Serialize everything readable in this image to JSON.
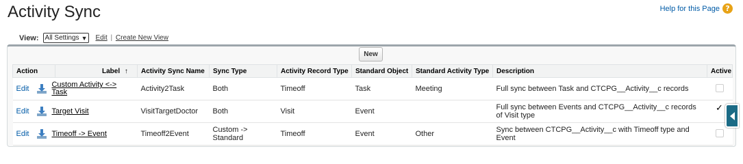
{
  "page": {
    "title": "Activity Sync",
    "help_link": "Help for this Page",
    "help_icon": "?"
  },
  "view": {
    "label": "View:",
    "selected": "All Settings",
    "edit_link": "Edit",
    "separator": "|",
    "create_link": "Create New View"
  },
  "toolbar": {
    "new_label": "New"
  },
  "table": {
    "headers": {
      "action": "Action",
      "label": "Label",
      "sort_indicator": "↑",
      "name": "Activity Sync Name",
      "sync_type": "Sync Type",
      "record_type": "Activity Record Type",
      "std_object": "Standard Object",
      "std_activity_type": "Standard Activity Type",
      "description": "Description",
      "active": "Active"
    },
    "rows": [
      {
        "edit": "Edit",
        "label": "Custom Activity <-> Task",
        "name": "Activity2Task",
        "sync_type": "Both",
        "record_type": "Timeoff",
        "std_object": "Task",
        "std_activity_type": "Meeting",
        "description": "Full sync between Task and CTCPG__Activity__c records",
        "active": false
      },
      {
        "edit": "Edit",
        "label": "Target Visit",
        "name": "VisitTargetDoctor",
        "sync_type": "Both",
        "record_type": "Visit",
        "std_object": "Event",
        "std_activity_type": "",
        "description": "Full sync between Events and CTCPG__Activity__c records of Visit type",
        "active": true
      },
      {
        "edit": "Edit",
        "label": "Timeoff -> Event",
        "name": "Timeoff2Event",
        "sync_type": "Custom -> Standard",
        "record_type": "Timeoff",
        "std_object": "Event",
        "std_activity_type": "Other",
        "description": "Sync between CTCPG__Activity__c with Timeoff type and Event",
        "active": false
      }
    ]
  },
  "colors": {
    "link": "#015ba7",
    "help_icon": "#e8a317",
    "side_tab": "#1b6b86"
  }
}
